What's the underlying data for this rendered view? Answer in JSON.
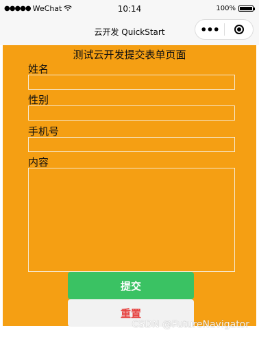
{
  "status_bar": {
    "carrier": "WeChat",
    "time": "10:14",
    "battery_percent": "100%",
    "battery_level": 1.0,
    "signal_icon": "signal-dots-icon",
    "wifi_icon": "wifi-icon"
  },
  "nav": {
    "title": "云开发 QuickStart",
    "more_icon": "more-dots-icon",
    "close_icon": "target-circle-icon"
  },
  "form": {
    "title": "测试云开发提交表单页面",
    "background_color": "#f59f13",
    "fields": {
      "name": {
        "label": "姓名",
        "value": ""
      },
      "gender": {
        "label": "性别",
        "value": ""
      },
      "phone": {
        "label": "手机号",
        "value": ""
      },
      "content": {
        "label": "内容",
        "value": ""
      }
    },
    "submit_label": "提交",
    "reset_label": "重置",
    "submit_color": "#3ac263",
    "reset_text_color": "#e64340"
  },
  "watermark": "CSDN @FutureNavigator"
}
